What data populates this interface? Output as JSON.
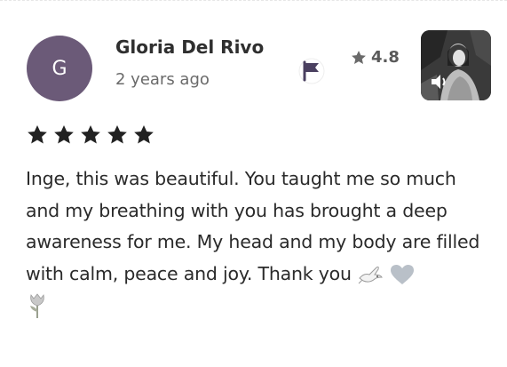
{
  "review": {
    "avatar_initial": "G",
    "avatar_color": "#6b5a78",
    "author_name": "Gloria Del Rivo",
    "posted_ago": "2 years ago",
    "average_rating": "4.8",
    "star_count": 5,
    "body_text": "Inge, this was beautiful. You taught me so much and my breathing with you has brought a deep awareness for me. My head and my body are filled with calm, peace and joy. Thank you",
    "emojis": [
      "dove-emoji",
      "grey-heart-emoji",
      "tulip-emoji"
    ]
  },
  "icons": {
    "flag": "flag-icon",
    "rating_star": "star-icon",
    "media": "speaker-icon"
  },
  "colors": {
    "star_fill": "#222222",
    "rating_star": "#6a6a6a"
  }
}
